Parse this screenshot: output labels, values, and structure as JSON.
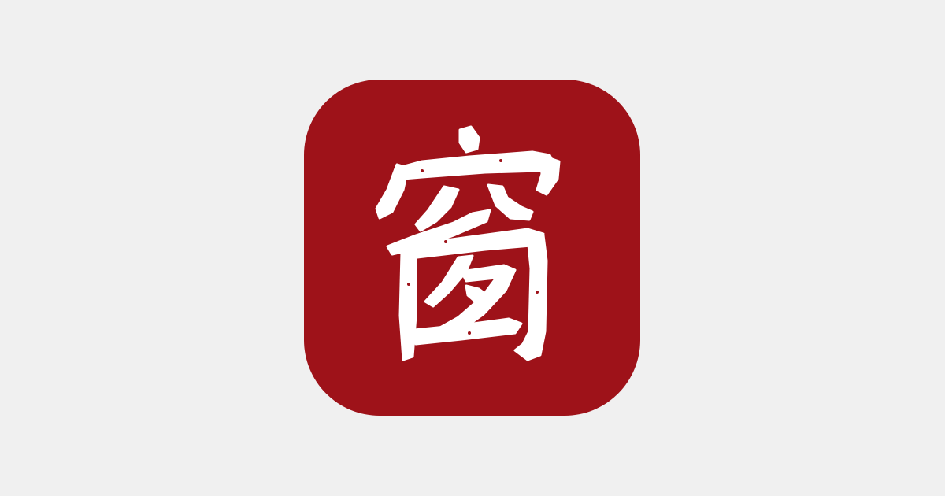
{
  "app_icon": {
    "name": "app-icon",
    "glyph": "窗",
    "background_color": "#9e1219",
    "glyph_color": "#ffffff"
  },
  "page": {
    "background_color": "#f0f0f0"
  }
}
